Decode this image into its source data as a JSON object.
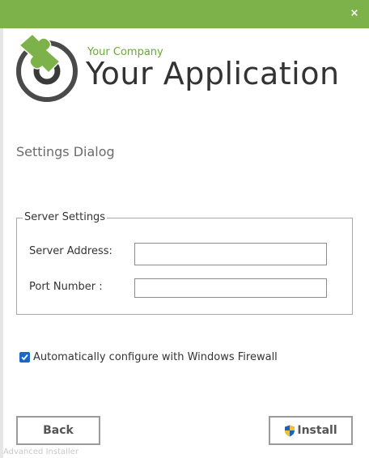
{
  "titlebar": {
    "close_label": "×",
    "accent": "#7db24a"
  },
  "header": {
    "company": "Your Company",
    "app_name": "Your Application",
    "logo_icon": "puzzle-logo-icon"
  },
  "dialog": {
    "title": "Settings Dialog"
  },
  "server_settings": {
    "legend": "Server Settings",
    "address_label": "Server Address:",
    "address_value": "",
    "port_label": "Port Number :",
    "port_value": ""
  },
  "firewall": {
    "label": "Automatically configure with Windows Firewall",
    "checked": true
  },
  "buttons": {
    "back": "Back",
    "install": "Install",
    "install_icon": "uac-shield-icon"
  },
  "footer": {
    "brand": "Advanced Installer"
  }
}
